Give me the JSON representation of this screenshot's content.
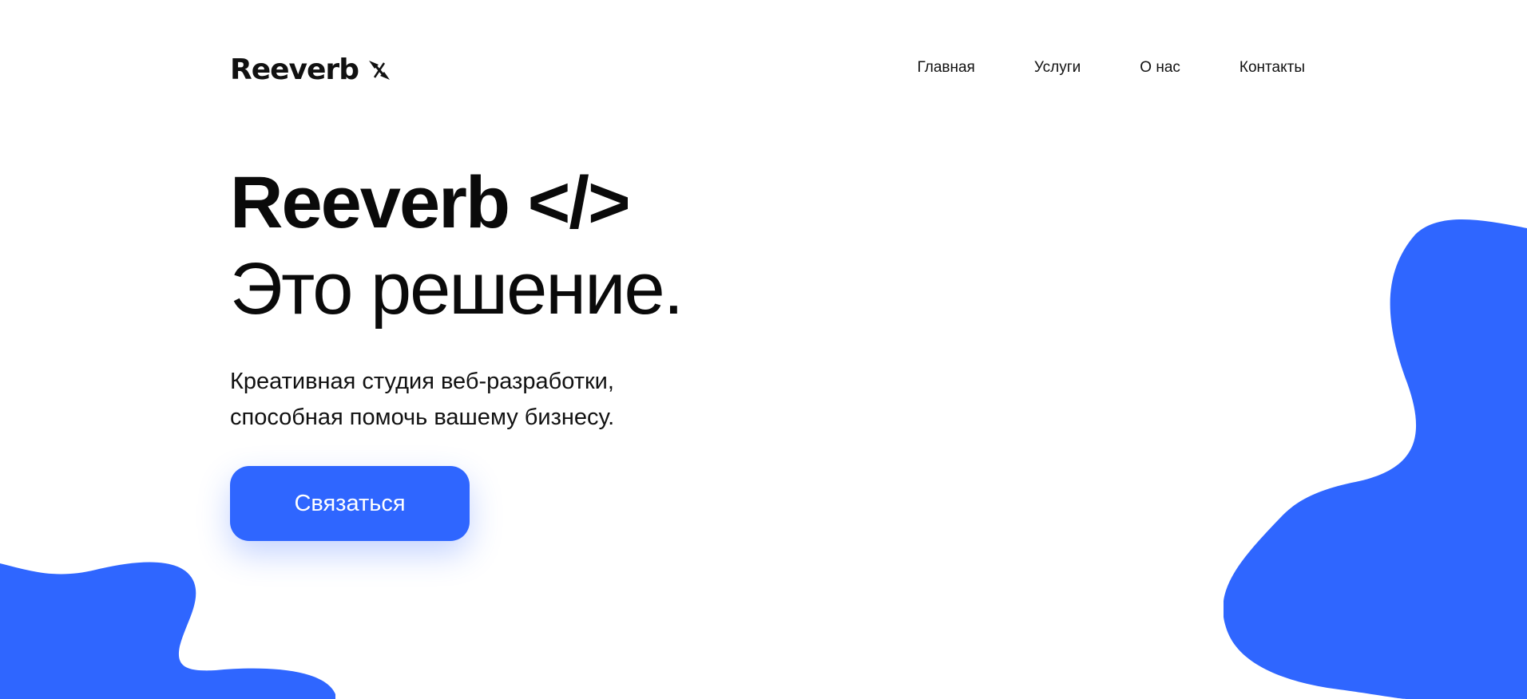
{
  "brand": {
    "logo_text": "Reeverb",
    "logo_icon": "arrows-icon"
  },
  "nav": {
    "items": [
      {
        "label": "Главная"
      },
      {
        "label": "Услуги"
      },
      {
        "label": "О нас"
      },
      {
        "label": "Контакты"
      }
    ]
  },
  "hero": {
    "title": "Reeverb </>",
    "subtitle": "Это решение.",
    "description_line1": "Креативная студия веб-разработки,",
    "description_line2": "способная помочь вашему бизнесу.",
    "cta_label": "Связаться"
  },
  "colors": {
    "accent": "#2f66ff",
    "text": "#0a0a0a",
    "background": "#ffffff"
  }
}
